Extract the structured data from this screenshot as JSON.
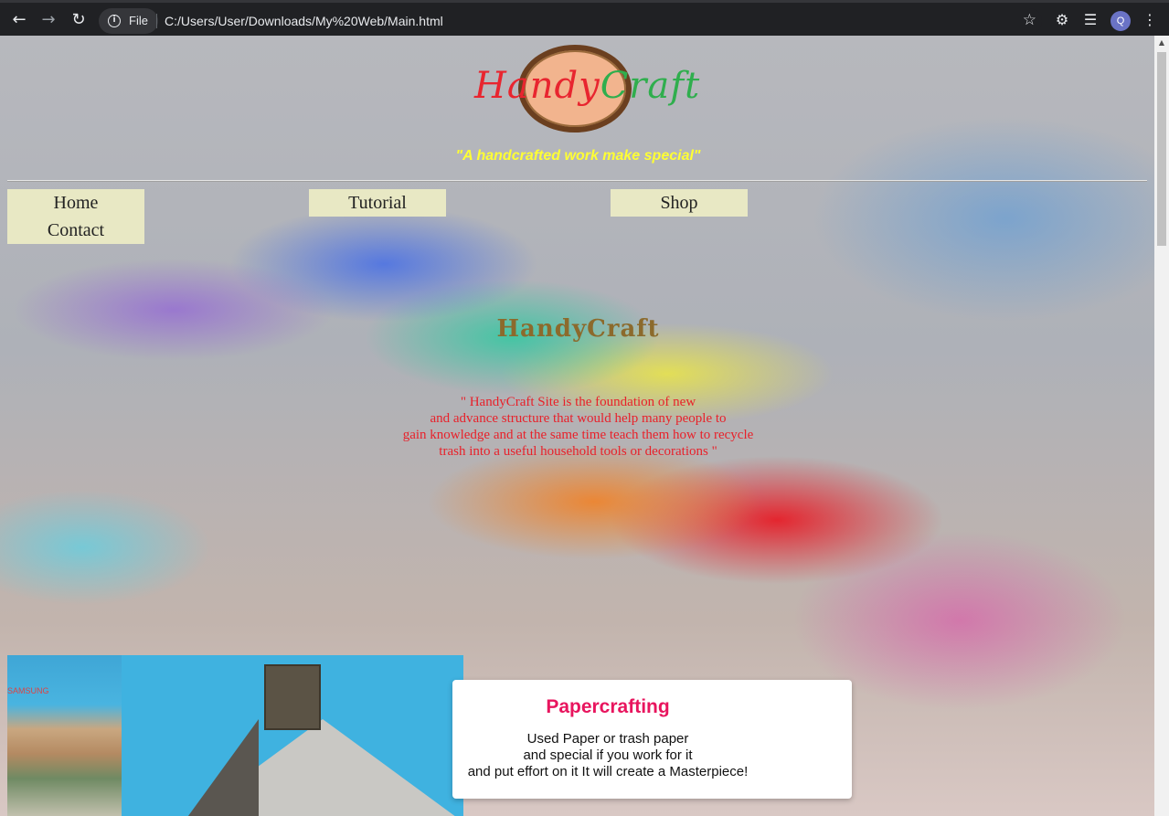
{
  "browser": {
    "file_label": "File",
    "url": "C:/Users/User/Downloads/My%20Web/Main.html",
    "profile_initial": "Q",
    "icons": [
      "back-arrow-icon",
      "forward-arrow-icon",
      "reload-icon",
      "info-icon",
      "star-icon",
      "extensions-icon",
      "media-queue-icon",
      "menu-dots-icon"
    ]
  },
  "site": {
    "logo": {
      "word1": "Handy",
      "word2": "Craft"
    },
    "tagline": "\"A handcrafted work make special\"",
    "nav": {
      "home": "Home",
      "contact": "Contact",
      "tutorial": "Tutorial",
      "shop": "Shop"
    },
    "hero": {
      "title": "HandyCraft",
      "line1": "\" HandyCraft Site is the foundation of new",
      "line2": "and advance structure that would help many people to",
      "line3": "gain knowledge and at the same time teach them how to recycle",
      "line4": "trash into a useful household tools or decorations \""
    },
    "card": {
      "title": "Papercrafting",
      "line1": "Used Paper or trash paper",
      "line2": "and special if you work for it",
      "line3": "and put effort on it It will create a Masterpiece!"
    },
    "photo_left_brand": "SAMSUNG"
  },
  "colors": {
    "tagline": "#ffff33",
    "nav_bg": "#e8e8c4",
    "hero_title": "#8c6a2c",
    "hero_text": "#e8212a",
    "card_title": "#e8155e"
  }
}
